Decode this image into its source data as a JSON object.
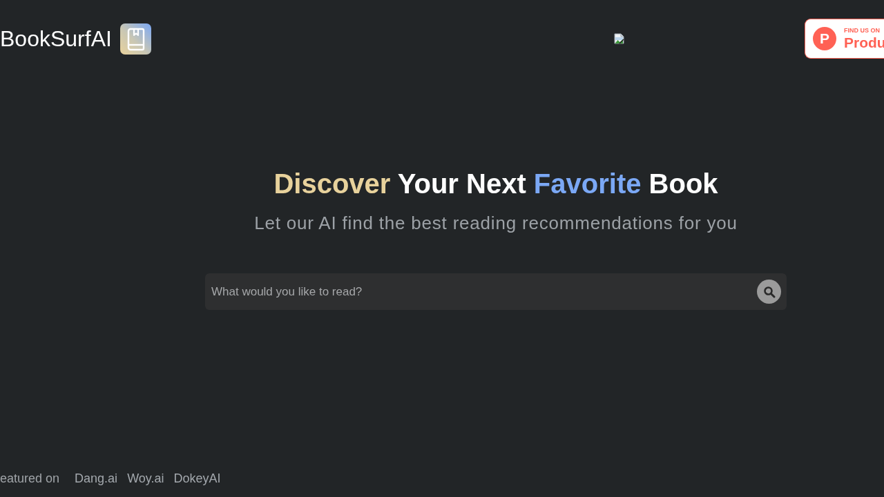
{
  "header": {
    "logo_text": "BookSurfAI",
    "badge": {
      "logo_glyph": "P",
      "kicker": "FIND US ON",
      "name": "Produ"
    }
  },
  "hero": {
    "heading": [
      {
        "text": "Discover",
        "color": "#e8d29c"
      },
      {
        "text": "Your Next",
        "color": "#ffffff"
      },
      {
        "text": "Favorite",
        "color": "#7ba8f5"
      },
      {
        "text": "Book",
        "color": "#ffffff"
      }
    ],
    "subtitle": "Let our AI find the best reading recommendations for you",
    "search": {
      "placeholder": "What would you like to read?"
    }
  },
  "footer": {
    "label": "eatured on",
    "links": [
      "Dang.ai",
      "Woy.ai",
      "DokeyAI"
    ]
  }
}
